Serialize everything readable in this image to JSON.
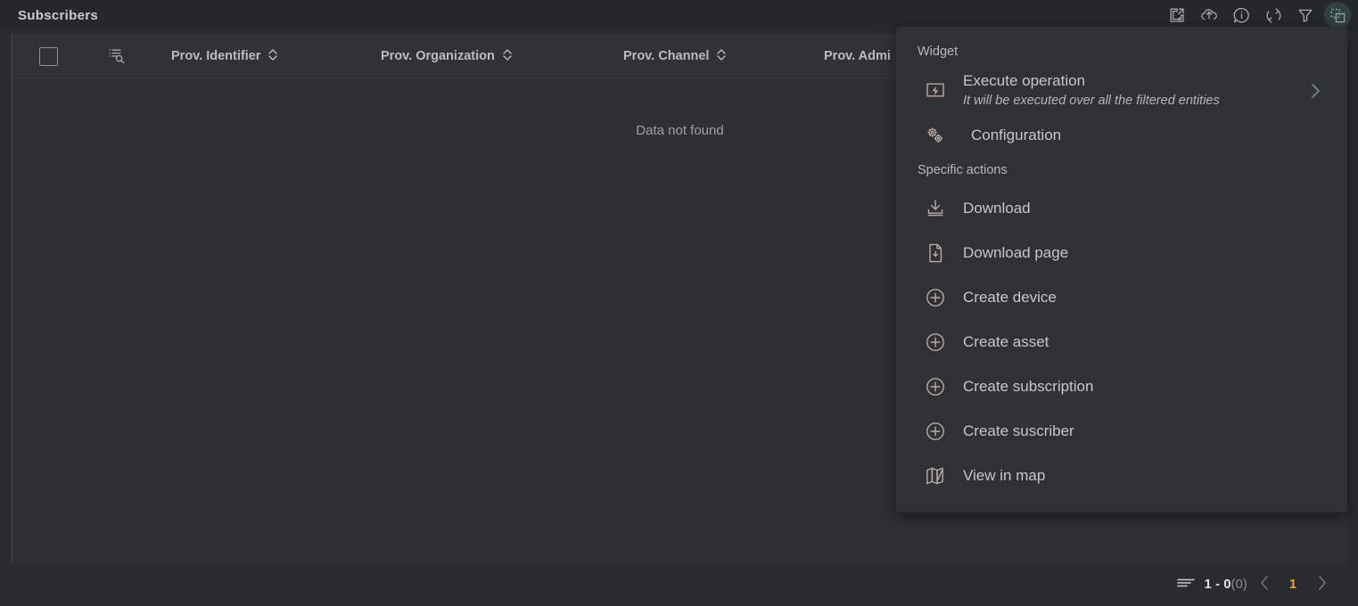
{
  "header": {
    "title": "Subscribers",
    "toolbar": [
      {
        "name": "open-new-window-icon",
        "label": "Open in new window"
      },
      {
        "name": "upload-cloud-icon",
        "label": "Upload"
      },
      {
        "name": "info-icon",
        "label": "Information"
      },
      {
        "name": "refresh-icon",
        "label": "Refresh"
      },
      {
        "name": "filter-icon",
        "label": "Filter"
      },
      {
        "name": "widget-icon",
        "label": "Widget actions"
      }
    ]
  },
  "table": {
    "columns": [
      {
        "label": "Prov. Identifier",
        "sortable": true
      },
      {
        "label": "Prov. Organization",
        "sortable": true
      },
      {
        "label": "Prov. Channel",
        "sortable": true
      },
      {
        "label": "Prov. Admi",
        "sortable": false
      }
    ],
    "empty_message": "Data not found"
  },
  "pagination": {
    "range": "1 - 0",
    "total": "(0)",
    "current_page": "1",
    "prev_label": "Previous page",
    "next_label": "Next page"
  },
  "menu": {
    "section_widget": "Widget",
    "section_specific": "Specific actions",
    "widget_items": [
      {
        "label": "Execute operation",
        "sublabel": "It will be executed over all the filtered entities",
        "icon": "lightning-box-icon",
        "has_chevron": true
      },
      {
        "label": "Configuration",
        "sublabel": "",
        "icon": "gears-icon",
        "has_chevron": false
      }
    ],
    "specific_items": [
      {
        "label": "Download",
        "icon": "download-tray-icon"
      },
      {
        "label": "Download page",
        "icon": "file-download-icon"
      },
      {
        "label": "Create device",
        "icon": "plus-circle-icon"
      },
      {
        "label": "Create asset",
        "icon": "plus-circle-icon"
      },
      {
        "label": "Create subscription",
        "icon": "plus-circle-icon"
      },
      {
        "label": "Create suscriber",
        "icon": "plus-circle-icon"
      },
      {
        "label": "View in map",
        "icon": "map-icon"
      }
    ]
  },
  "colors": {
    "accent_teal": "#5f8179",
    "accent_orange": "#e8a33d",
    "panel_bg": "#2f3033",
    "menu_bg": "#303134",
    "text": "#c4c7cc"
  }
}
